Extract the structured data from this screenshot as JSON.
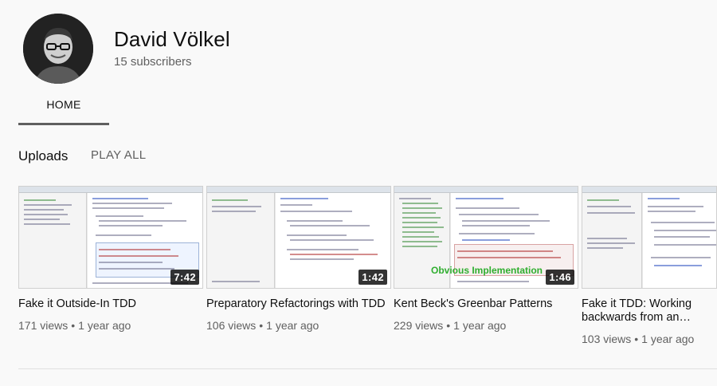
{
  "channel": {
    "name": "David Völkel",
    "subscribers": "15 subscribers"
  },
  "tabs": [
    {
      "label": "HOME"
    }
  ],
  "shelf": {
    "title": "Uploads",
    "play_all": "PLAY ALL"
  },
  "videos": [
    {
      "title": "Fake it Outside-In TDD",
      "duration": "7:42",
      "views": "171 views",
      "age": "1 year ago"
    },
    {
      "title": "Preparatory Refactorings with TDD",
      "duration": "1:42",
      "views": "106 views",
      "age": "1 year ago"
    },
    {
      "title": "Kent Beck's Greenbar Patterns",
      "duration": "1:46",
      "views": "229 views",
      "age": "1 year ago",
      "overlay": "Obvious Implementation"
    },
    {
      "title": "Fake it TDD: Working backwards from an…",
      "duration": "",
      "views": "103 views",
      "age": "1 year ago"
    }
  ],
  "meta_separator": "•"
}
